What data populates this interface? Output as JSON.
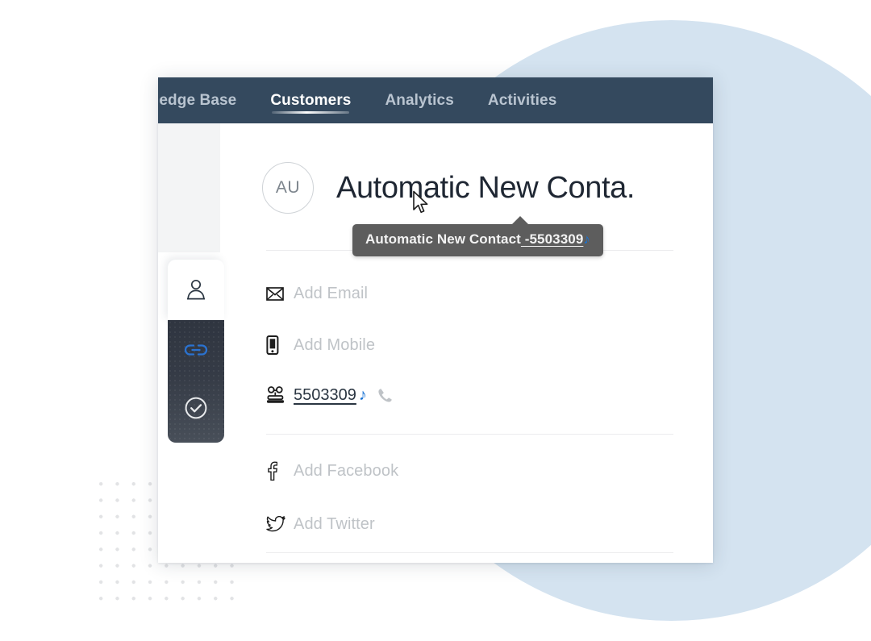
{
  "navbar": {
    "background_color": "#34495e",
    "items": [
      {
        "label": "ledge Base",
        "active": false,
        "clipped": true
      },
      {
        "label": "Customers",
        "active": true,
        "clipped": false
      },
      {
        "label": "Analytics",
        "active": false,
        "clipped": false
      },
      {
        "label": "Activities",
        "active": false,
        "clipped": false
      }
    ]
  },
  "rail": {
    "tabs": [
      {
        "icon": "person-icon",
        "state": "selected-light"
      },
      {
        "icon": "link-icon",
        "state": "active-dark",
        "accent_color": "#1a73d4"
      },
      {
        "icon": "check-circle-icon",
        "state": "dark"
      }
    ]
  },
  "contact": {
    "avatar_initials": "AU",
    "name": "Automatic New Conta.",
    "fields": [
      {
        "icon": "envelope-icon",
        "label": "Add Email",
        "value": "",
        "placeholder": true
      },
      {
        "icon": "mobile-phone-icon",
        "label": "Add Mobile",
        "value": "",
        "placeholder": true
      },
      {
        "icon": "telephone-icon",
        "label": "",
        "value": "5503309",
        "placeholder": false,
        "call_action": "call-icon"
      }
    ],
    "social_fields": [
      {
        "icon": "facebook-icon",
        "label": "Add Facebook",
        "placeholder": true
      },
      {
        "icon": "twitter-icon",
        "label": "Add Twitter",
        "placeholder": true
      }
    ]
  },
  "tooltip": {
    "text_plain": "Automatic New Contact",
    "text_underlined": " -5503309",
    "phone_glyph": "♪",
    "background_color": "#5d5d5d"
  },
  "decoration": {
    "circle_color": "#d4e3f0",
    "dot_grid_color": "#e2e3e5"
  }
}
